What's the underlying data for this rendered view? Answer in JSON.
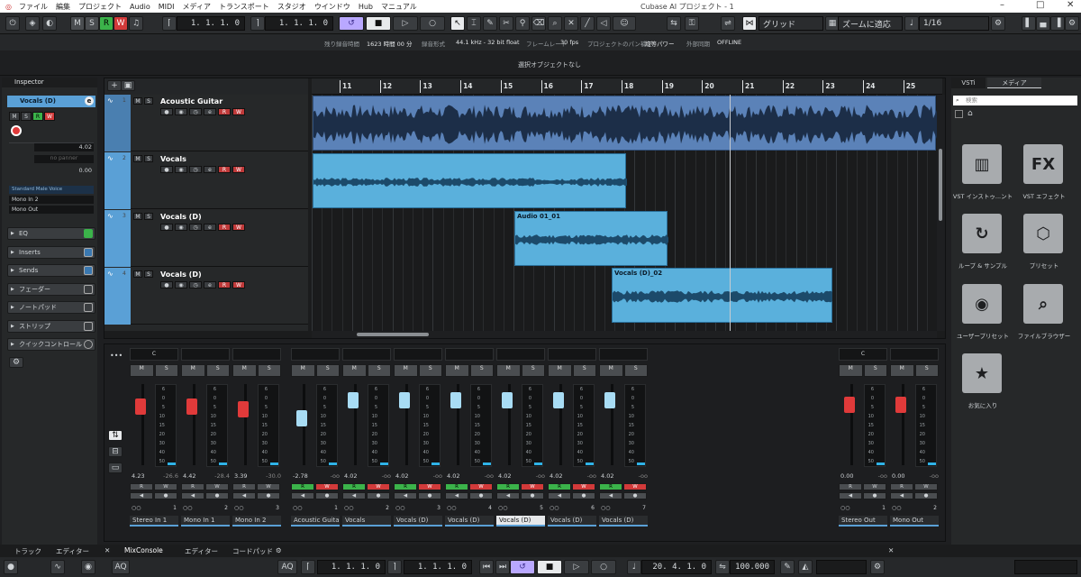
{
  "title_bar": {
    "menu": [
      "ファイル",
      "編集",
      "プロジェクト",
      "Audio",
      "MIDI",
      "メディア",
      "トランスポート",
      "スタジオ",
      "ウインドウ",
      "Hub",
      "マニュアル"
    ],
    "app_title": "Cubase AI プロジェクト - 1"
  },
  "toolbar": {
    "mode_buttons": [
      "M",
      "S",
      "R",
      "W"
    ],
    "left_locator": "1. 1. 1.   0",
    "right_locator": "1. 1. 1.   0",
    "snap_label": "グリッド",
    "zoom_label": "ズームに適応",
    "quantize": "1/16"
  },
  "info_bar": {
    "items": [
      {
        "label": "残り録音時間",
        "value": "1623 時間 00 分"
      },
      {
        "label": "録音形式",
        "value": "44.1 kHz - 32 bit float"
      },
      {
        "label": "フレームレート",
        "value": "30 fps"
      },
      {
        "label": "プロジェクトのパン補正",
        "value": "均等パワー"
      },
      {
        "label": "外部同期",
        "value": "OFFLINE"
      }
    ]
  },
  "selection": "選択オブジェクトなし",
  "inspector": {
    "tab": "Inspector",
    "track_name": "Vocals (D)",
    "volume": "4.02",
    "pan": "no panner",
    "pan_value": "0.00",
    "preset": "Standard Male Voice",
    "input": "Mono In 2",
    "output": "Mono Out",
    "sections": [
      "EQ",
      "Inserts",
      "Sends",
      "フェーダー",
      "ノートパッド",
      "ストリップ",
      "クイックコントロール"
    ]
  },
  "tracks": [
    {
      "num": "1",
      "name": "Acoustic Guitar"
    },
    {
      "num": "2",
      "name": "Vocals"
    },
    {
      "num": "3",
      "name": "Vocals (D)"
    },
    {
      "num": "4",
      "name": "Vocals (D)"
    }
  ],
  "ruler": [
    "11",
    "12",
    "13",
    "14",
    "15",
    "16",
    "17",
    "18",
    "19",
    "20",
    "21",
    "22",
    "23",
    "24",
    "25"
  ],
  "clips": [
    {
      "name": ""
    },
    {
      "name": ""
    },
    {
      "name": "Audio 01_01"
    },
    {
      "name": "Vocals (D)_02"
    }
  ],
  "mixer": {
    "channels": [
      {
        "name": "Stereo In 1",
        "value": "4.23",
        "peak": "-26.6",
        "io": "1",
        "pan": "C"
      },
      {
        "name": "Mono In 1",
        "value": "4.42",
        "peak": "-28.4",
        "io": "2",
        "pan": ""
      },
      {
        "name": "Mono In 2",
        "value": "3.39",
        "peak": "-30.0",
        "io": "3",
        "pan": ""
      },
      {
        "name": "Acoustic Guitar",
        "value": "-2.78",
        "peak": "-oo",
        "io": "1",
        "pan": ""
      },
      {
        "name": "Vocals",
        "value": "4.02",
        "peak": "-oo",
        "io": "2",
        "pan": ""
      },
      {
        "name": "Vocals (D)",
        "value": "4.02",
        "peak": "-oo",
        "io": "3",
        "pan": ""
      },
      {
        "name": "Vocals (D)",
        "value": "4.02",
        "peak": "-oo",
        "io": "4",
        "pan": ""
      },
      {
        "name": "Vocals (D)",
        "value": "4.02",
        "peak": "-oo",
        "io": "5",
        "pan": ""
      },
      {
        "name": "Vocals (D)",
        "value": "4.02",
        "peak": "-oo",
        "io": "6",
        "pan": ""
      },
      {
        "name": "Vocals (D)",
        "value": "4.02",
        "peak": "-oo",
        "io": "7",
        "pan": ""
      },
      {
        "name": "Stereo Out",
        "value": "0.00",
        "peak": "-oo",
        "io": "1",
        "pan": "C"
      },
      {
        "name": "Mono Out",
        "value": "0.00",
        "peak": "-oo",
        "io": "2",
        "pan": ""
      }
    ],
    "scale": [
      "6",
      "0",
      "5",
      "10",
      "15",
      "20",
      "30",
      "40",
      "50"
    ]
  },
  "right_panel": {
    "tabs": [
      "VSTi",
      "メディア"
    ],
    "search_placeholder": "検索",
    "tiles": [
      {
        "label": "VST インストゥ...ント",
        "glyph": "▥"
      },
      {
        "label": "VST エフェクト",
        "glyph": "FX"
      },
      {
        "label": "ループ & サンプル",
        "glyph": "↻"
      },
      {
        "label": "プリセット",
        "glyph": "⬡"
      },
      {
        "label": "ユーザープリセット",
        "glyph": "◉"
      },
      {
        "label": "ファイルブラウザー",
        "glyph": "⌕"
      },
      {
        "label": "お気に入り",
        "glyph": "★"
      }
    ]
  },
  "bottom_tabs": [
    "トラック",
    "エディター",
    "MixConsole",
    "エディター",
    "コードパッド"
  ],
  "transport": {
    "aq": "AQ",
    "left": "1. 1. 1.   0",
    "right": "1. 1. 1.   0",
    "position": "20. 4. 1.   0",
    "tempo": "100.000"
  }
}
